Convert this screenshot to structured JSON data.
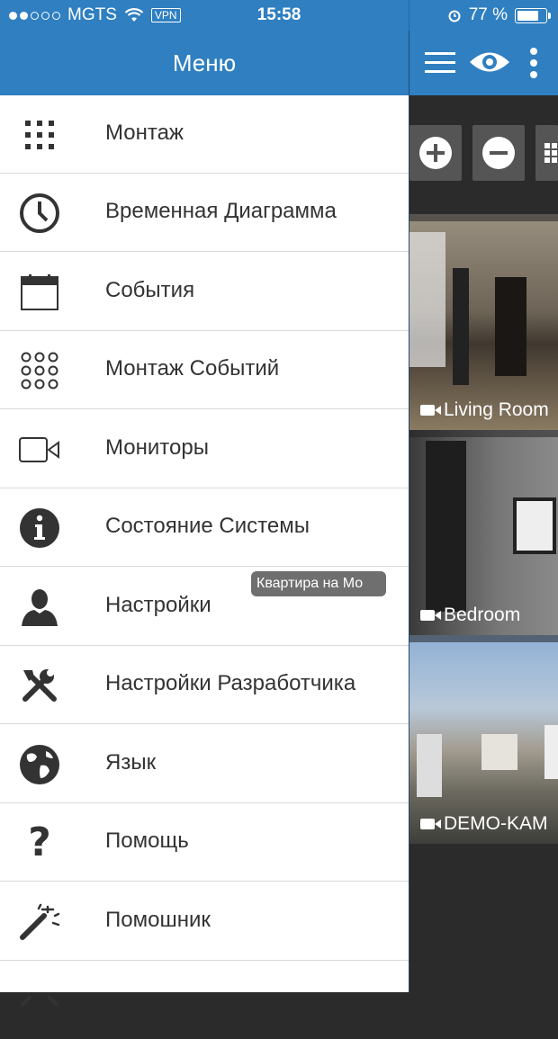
{
  "status_bar": {
    "carrier": "MGTS",
    "vpn": "VPN",
    "time": "15:58",
    "battery": "77 %",
    "battery_level": 0.77
  },
  "menu": {
    "title": "Меню",
    "items": [
      {
        "label": "Монтаж",
        "icon": "grid-icon"
      },
      {
        "label": "Временная Диаграмма",
        "icon": "clock-icon"
      },
      {
        "label": "События",
        "icon": "calendar-icon"
      },
      {
        "label": "Монтаж Событий",
        "icon": "circles-grid-icon"
      },
      {
        "label": "Мониторы",
        "icon": "video-camera-icon"
      },
      {
        "label": "Состояние Системы",
        "icon": "info-icon"
      },
      {
        "label": "Настройки",
        "icon": "user-icon"
      },
      {
        "label": "Настройки Разработчика",
        "icon": "tools-icon"
      },
      {
        "label": "Язык",
        "icon": "globe-icon"
      },
      {
        "label": "Помощь",
        "icon": "question-icon"
      },
      {
        "label": "Помошник",
        "icon": "magic-wand-icon"
      }
    ]
  },
  "toast": "Квартира на Мо",
  "cameras": [
    {
      "name": "Living Room"
    },
    {
      "name": "Bedroom"
    },
    {
      "name": "DEMO-KAM"
    }
  ],
  "colors": {
    "header": "#2f7fc1",
    "menu_bg": "#ffffff",
    "text": "#333333"
  }
}
